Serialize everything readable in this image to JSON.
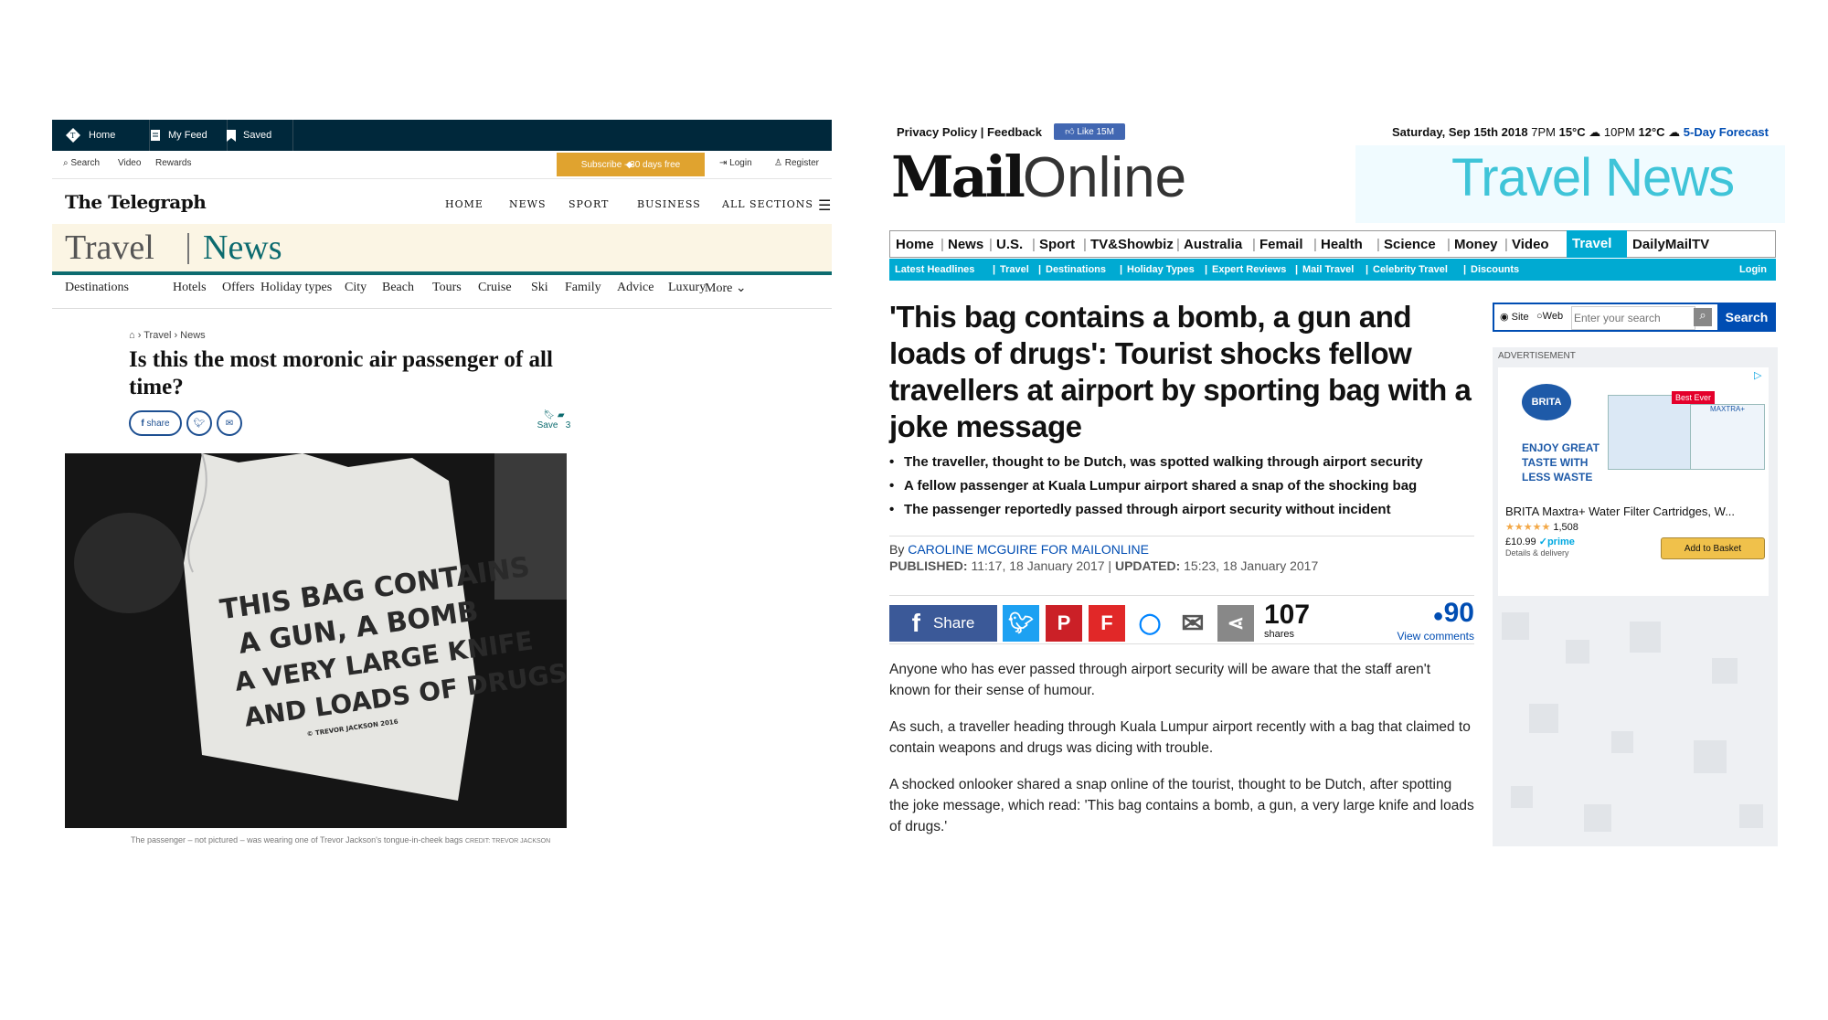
{
  "telegraph": {
    "topbar": {
      "home": "Home",
      "myfeed": "My Feed",
      "saved": "Saved"
    },
    "subbar": {
      "search": "Search",
      "video": "Video",
      "rewards": "Rewards",
      "subscribe": "Subscribe - 30 days free",
      "login": "Login",
      "register": "Register"
    },
    "logo": "The Telegraph",
    "nav": [
      "HOME",
      "NEWS",
      "SPORT",
      "BUSINESS",
      "ALL SECTIONS"
    ],
    "banner": {
      "travel": "Travel",
      "news": "News"
    },
    "subnav": [
      "Destinations",
      "Hotels",
      "Offers",
      "Holiday types",
      "City",
      "Beach",
      "Tours",
      "Cruise",
      "Ski",
      "Family",
      "Advice",
      "Luxury",
      "More"
    ],
    "breadcrumb": [
      "Travel",
      "News"
    ],
    "headline": "Is this the most moronic air passenger of all time?",
    "share_label": "share",
    "save_label": "Save",
    "comment_count": "3",
    "bag_text": [
      "THIS BAG CONTAINS",
      "A GUN, A BOMB",
      "A VERY LARGE KNIFE",
      "AND LOADS OF DRUGS"
    ],
    "bag_small": "© TREVOR JACKSON 2016",
    "caption": "The passenger – not pictured – was wearing one of Trevor Jackson's tongue-in-cheek bags",
    "credit": "CREDIT: TREVOR JACKSON"
  },
  "mail": {
    "top": {
      "privacy": "Privacy Policy",
      "feedback": "Feedback",
      "like": "Like 15M",
      "date": "Saturday, Sep 15th 2018",
      "t1time": "7PM",
      "t1": "15°C",
      "t2time": "10PM",
      "t2": "12°C",
      "forecast": "5-Day Forecast"
    },
    "logo_bold": "Mail",
    "logo_light": "Online",
    "section_banner": "Travel News",
    "nav": [
      "Home",
      "News",
      "U.S.",
      "Sport",
      "TV&Showbiz",
      "Australia",
      "Femail",
      "Health",
      "Science",
      "Money",
      "Video",
      "Travel",
      "DailyMailTV"
    ],
    "subnav": [
      "Latest Headlines",
      "Travel",
      "Destinations",
      "Holiday Types",
      "Expert Reviews",
      "Mail Travel",
      "Celebrity Travel",
      "Discounts"
    ],
    "subnav_login": "Login",
    "headline": "'This bag contains a bomb, a gun and loads of drugs': Tourist shocks fellow travellers at airport by sporting bag with a joke message",
    "bullets": [
      "The traveller, thought to be Dutch, was spotted walking through airport security",
      "A fellow passenger at Kuala Lumpur airport shared a snap of the shocking bag",
      "The passenger reportedly passed through airport security without incident"
    ],
    "byline_prefix": "By",
    "byline": "CAROLINE MCGUIRE FOR MAILONLINE",
    "published_label": "PUBLISHED:",
    "published": "11:17, 18 January 2017",
    "updated_label": "UPDATED:",
    "updated": "15:23, 18 January 2017",
    "share_label": "Share",
    "shares_count": "107",
    "shares_label": "shares",
    "comments_count": "90",
    "comments_label": "View comments",
    "body": [
      "Anyone who has ever passed through airport security will be aware that the staff aren't known for their sense of humour.",
      "As such, a traveller heading through Kuala Lumpur airport recently with a bag that claimed to contain weapons and drugs was dicing with trouble.",
      "A shocked onlooker shared a snap online of the tourist, thought to be Dutch, after spotting the joke message, which read: 'This bag contains a bomb, a gun, a very large knife and loads of drugs.'"
    ],
    "search": {
      "site": "Site",
      "web": "Web",
      "placeholder": "Enter your search",
      "button": "Search"
    },
    "ad": {
      "label": "ADVERTISEMENT",
      "brand": "BRITA",
      "tagline": [
        "ENJOY GREAT",
        "TASTE WITH",
        "LESS WASTE"
      ],
      "badge": "Best Ever",
      "box_label": "MAXTRA+",
      "title": "BRITA Maxtra+ Water Filter Cartridges, W...",
      "rating_count": "1,508",
      "price": "£10.99",
      "prime": "prime",
      "delivery": "Details & delivery",
      "button": "Add to Basket"
    }
  }
}
